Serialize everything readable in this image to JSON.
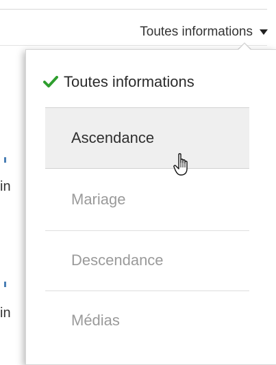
{
  "filter": {
    "current_label": "Toutes informations",
    "caret_icon": "caret-down-icon"
  },
  "background": {
    "fragment_1": "in",
    "fragment_2": "in"
  },
  "dropdown": {
    "items": [
      {
        "label": "Toutes informations",
        "state": "selected",
        "icon": "checkmark-icon"
      },
      {
        "label": "Ascendance",
        "state": "hover"
      },
      {
        "label": "Mariage",
        "state": "disabled"
      },
      {
        "label": "Descendance",
        "state": "disabled"
      },
      {
        "label": "Médias",
        "state": "disabled"
      }
    ]
  },
  "colors": {
    "checkmark": "#2e9e2e",
    "hover_background": "#efefef",
    "disabled_text": "#9a9a9a",
    "link_blue": "#4a7fb5"
  },
  "cursor_icon": "hand-pointer-icon"
}
